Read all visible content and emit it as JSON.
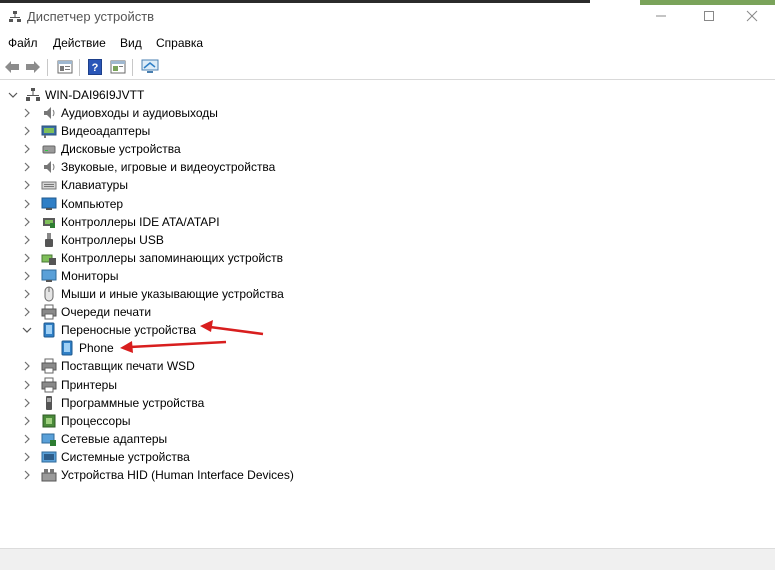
{
  "window": {
    "title": "Диспетчер устройств"
  },
  "menu": [
    "Файл",
    "Действие",
    "Вид",
    "Справка"
  ],
  "tree": {
    "root": "WIN-DAI96I9JVTT",
    "categories": [
      {
        "label": "Аудиовходы и аудиовыходы",
        "icon": "speaker-icon"
      },
      {
        "label": "Видеоадаптеры",
        "icon": "display-adapter-icon"
      },
      {
        "label": "Дисковые устройства",
        "icon": "disk-drive-icon"
      },
      {
        "label": "Звуковые, игровые и видеоустройства",
        "icon": "speaker-icon"
      },
      {
        "label": "Клавиатуры",
        "icon": "keyboard-icon"
      },
      {
        "label": "Компьютер",
        "icon": "computer-icon"
      },
      {
        "label": "Контроллеры IDE ATA/ATAPI",
        "icon": "ide-controller-icon"
      },
      {
        "label": "Контроллеры USB",
        "icon": "usb-icon"
      },
      {
        "label": "Контроллеры запоминающих устройств",
        "icon": "storage-controller-icon"
      },
      {
        "label": "Мониторы",
        "icon": "monitor-icon"
      },
      {
        "label": "Мыши и иные указывающие устройства",
        "icon": "mouse-icon"
      },
      {
        "label": "Очереди печати",
        "icon": "printer-icon"
      },
      {
        "label": "Переносные устройства",
        "icon": "portable-device-icon",
        "expanded": true,
        "children": [
          {
            "label": "Phone",
            "icon": "phone-icon"
          }
        ]
      },
      {
        "label": "Поставщик печати WSD",
        "icon": "printer-icon"
      },
      {
        "label": "Принтеры",
        "icon": "printer-icon"
      },
      {
        "label": "Программные устройства",
        "icon": "software-device-icon"
      },
      {
        "label": "Процессоры",
        "icon": "processor-icon"
      },
      {
        "label": "Сетевые адаптеры",
        "icon": "network-adapter-icon"
      },
      {
        "label": "Системные устройства",
        "icon": "system-device-icon"
      },
      {
        "label": "Устройства HID (Human Interface Devices)",
        "icon": "hid-icon"
      }
    ]
  },
  "colors": {
    "annotation_arrow": "#d81e1e",
    "icon_blue": "#2f7fc6",
    "chevron": "#707070"
  }
}
